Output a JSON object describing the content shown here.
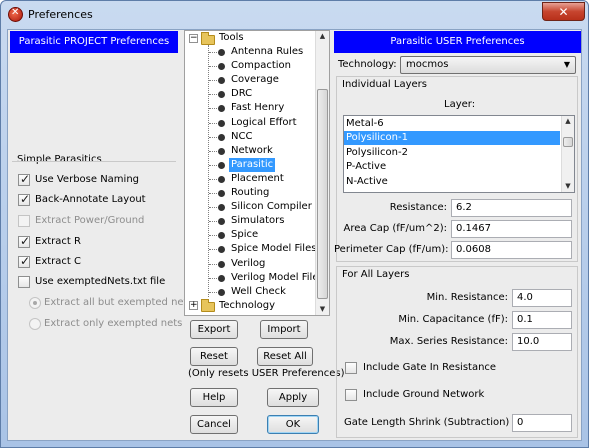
{
  "window": {
    "title": "Preferences",
    "close_glyph": "✕"
  },
  "left_panel": {
    "header": "Parasitic PROJECT Preferences",
    "group_title": "Simple Parasitics",
    "options": [
      {
        "label": "Use Verbose Naming",
        "checked": true,
        "enabled": true
      },
      {
        "label": "Back-Annotate Layout",
        "checked": true,
        "enabled": true
      },
      {
        "label": "Extract Power/Ground",
        "checked": false,
        "enabled": false
      },
      {
        "label": "Extract R",
        "checked": true,
        "enabled": true
      },
      {
        "label": "Extract C",
        "checked": true,
        "enabled": true
      },
      {
        "label": "Use exemptedNets.txt file",
        "checked": false,
        "enabled": true
      }
    ],
    "radios": [
      {
        "label": "Extract all but exempted nets",
        "selected": true
      },
      {
        "label": "Extract only exempted nets",
        "selected": false
      }
    ]
  },
  "tree": {
    "root": {
      "label": "Tools",
      "expander": "−"
    },
    "items": [
      "Antenna Rules",
      "Compaction",
      "Coverage",
      "DRC",
      "Fast Henry",
      "Logical Effort",
      "NCC",
      "Network",
      "Parasitic",
      "Placement",
      "Routing",
      "Silicon Compiler",
      "Simulators",
      "Spice",
      "Spice Model Files",
      "Verilog",
      "Verilog Model Files",
      "Well Check"
    ],
    "selected": "Parasitic",
    "next_root": {
      "label": "Technology",
      "expander": "+"
    }
  },
  "buttons": {
    "export": "Export",
    "import": "Import",
    "reset": "Reset",
    "reset_all": "Reset All",
    "reset_note": "(Only resets USER Preferences)",
    "help": "Help",
    "apply": "Apply",
    "cancel": "Cancel",
    "ok": "OK"
  },
  "right_panel": {
    "header": "Parasitic USER Preferences",
    "technology_label": "Technology:",
    "technology_value": "mocmos",
    "individual_title": "Individual Layers",
    "layer_label": "Layer:",
    "layers": [
      "Metal-6",
      "Polysilicon-1",
      "Polysilicon-2",
      "P-Active",
      "N-Active"
    ],
    "selected_layer": "Polysilicon-1",
    "resistance_label": "Resistance:",
    "resistance_value": "6.2",
    "area_cap_label": "Area Cap (fF/um^2):",
    "area_cap_value": "0.1467",
    "perim_cap_label": "Perimeter Cap (fF/um):",
    "perim_cap_value": "0.0608",
    "all_layers_title": "For All Layers",
    "min_res_label": "Min. Resistance:",
    "min_res_value": "4.0",
    "min_cap_label": "Min. Capacitance (fF):",
    "min_cap_value": "0.1",
    "max_series_label": "Max. Series Resistance:",
    "max_series_value": "10.0",
    "gate_in_res_label": "Include Gate In Resistance",
    "ground_net_label": "Include Ground Network",
    "gate_shrink_label": "Gate Length Shrink (Subtraction) um:",
    "gate_shrink_value": "0"
  }
}
